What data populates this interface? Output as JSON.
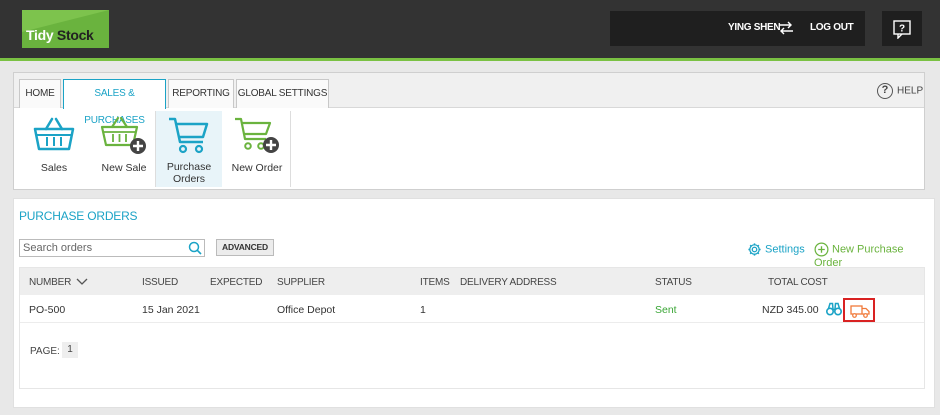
{
  "header": {
    "logo_tidy": "Tidy",
    "logo_stock": "Stock",
    "user_name": "YING SHEN",
    "logout_label": "LOG OUT",
    "swap_icon": "swap-arrows-icon",
    "help_icon": "help-chat-icon"
  },
  "tabs": [
    {
      "label": "HOME",
      "active": false
    },
    {
      "label": "SALES & PURCHASES",
      "active": true
    },
    {
      "label": "REPORTING",
      "active": false
    },
    {
      "label": "GLOBAL SETTINGS",
      "active": false
    }
  ],
  "help_label": "HELP",
  "toolbar": {
    "sales": "Sales",
    "new_sale": "New Sale",
    "purchase_orders_line1": "Purchase",
    "purchase_orders_line2": "Orders",
    "new_order": "New Order"
  },
  "page": {
    "title": "PURCHASE ORDERS",
    "search_placeholder": "Search orders",
    "advanced_label": "ADVANCED",
    "settings_label": "Settings",
    "new_po_label": "New Purchase Order"
  },
  "table": {
    "columns": {
      "number": "NUMBER",
      "issued": "ISSUED",
      "expected": "EXPECTED",
      "supplier": "SUPPLIER",
      "items": "ITEMS",
      "delivery_address": "DELIVERY ADDRESS",
      "status": "STATUS",
      "total_cost": "TOTAL COST"
    },
    "rows": [
      {
        "number": "PO-500",
        "issued": "15 Jan 2021",
        "expected": "",
        "supplier": "Office Depot",
        "items": "1",
        "delivery_address": "",
        "status": "Sent",
        "total_cost": "NZD 345.00"
      }
    ]
  },
  "pager": {
    "label": "PAGE:",
    "current": "1"
  },
  "colors": {
    "accent_blue": "#1ba3c6",
    "brand_green": "#6ab33e",
    "status_green": "#3aa635",
    "highlight_red": "#d92222",
    "truck_orange": "#f07a3a"
  }
}
